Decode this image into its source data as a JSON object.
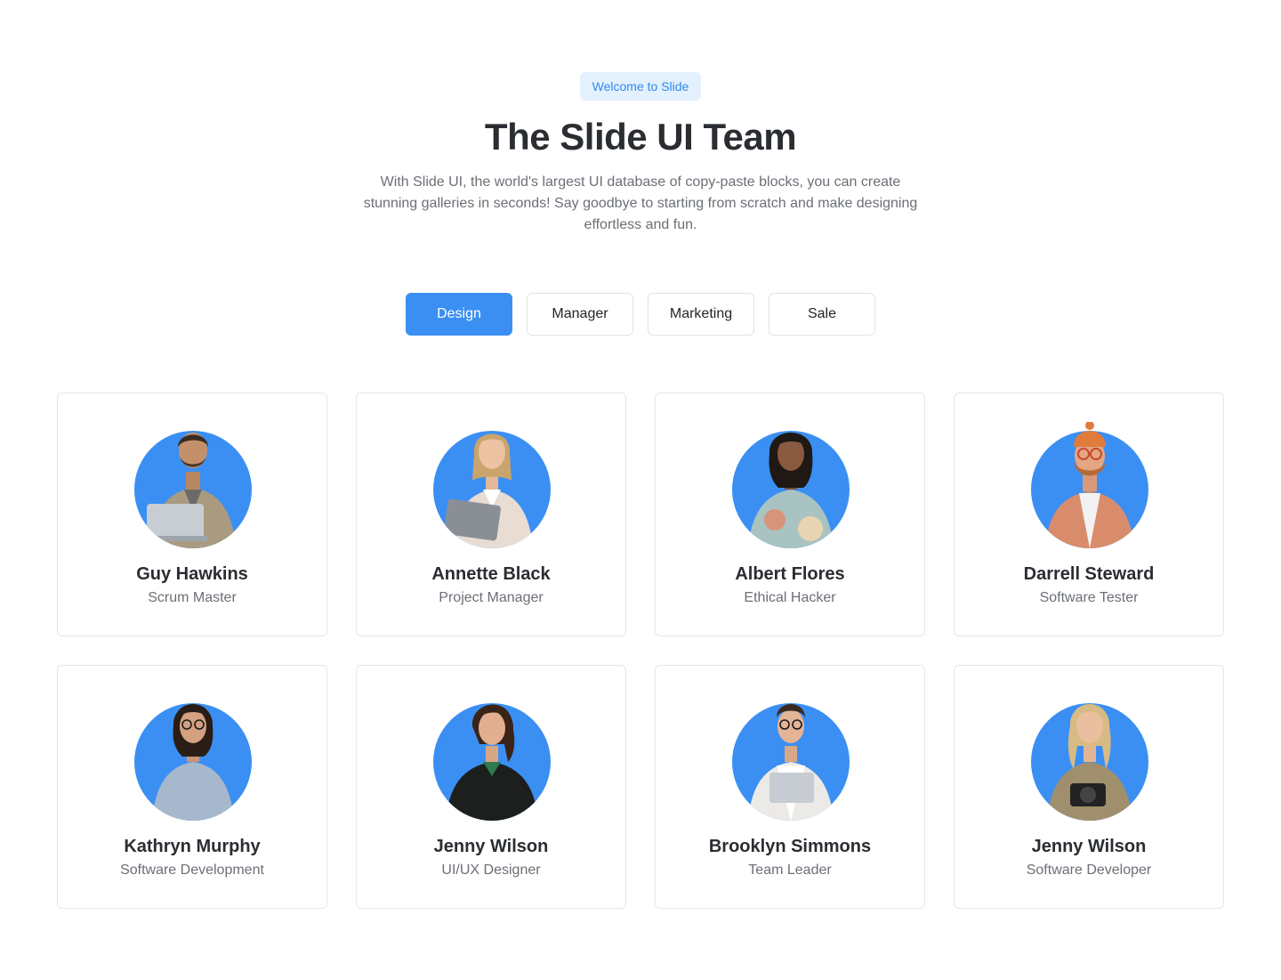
{
  "hero": {
    "badge": "Welcome to Slide",
    "title": "The Slide UI Team",
    "subtitle": "With Slide UI, the world's largest UI database of copy-paste blocks, you can create stunning galleries in seconds! Say goodbye to starting from scratch and make designing effortless and fun."
  },
  "tabs": [
    {
      "label": "Design",
      "active": true
    },
    {
      "label": "Manager",
      "active": false
    },
    {
      "label": "Marketing",
      "active": false
    },
    {
      "label": "Sale",
      "active": false
    }
  ],
  "colors": {
    "accent": "#3b8ff3",
    "badge_bg": "#e3f0fd",
    "badge_text": "#2f8af0"
  },
  "team": [
    {
      "name": "Guy Hawkins",
      "role": "Scrum Master"
    },
    {
      "name": "Annette Black",
      "role": "Project Manager"
    },
    {
      "name": "Albert Flores",
      "role": "Ethical Hacker"
    },
    {
      "name": "Darrell Steward",
      "role": "Software Tester"
    },
    {
      "name": "Kathryn Murphy",
      "role": "Software Development"
    },
    {
      "name": "Jenny Wilson",
      "role": "UI/UX Designer"
    },
    {
      "name": "Brooklyn Simmons",
      "role": "Team Leader"
    },
    {
      "name": "Jenny Wilson",
      "role": "Software Developer"
    }
  ]
}
